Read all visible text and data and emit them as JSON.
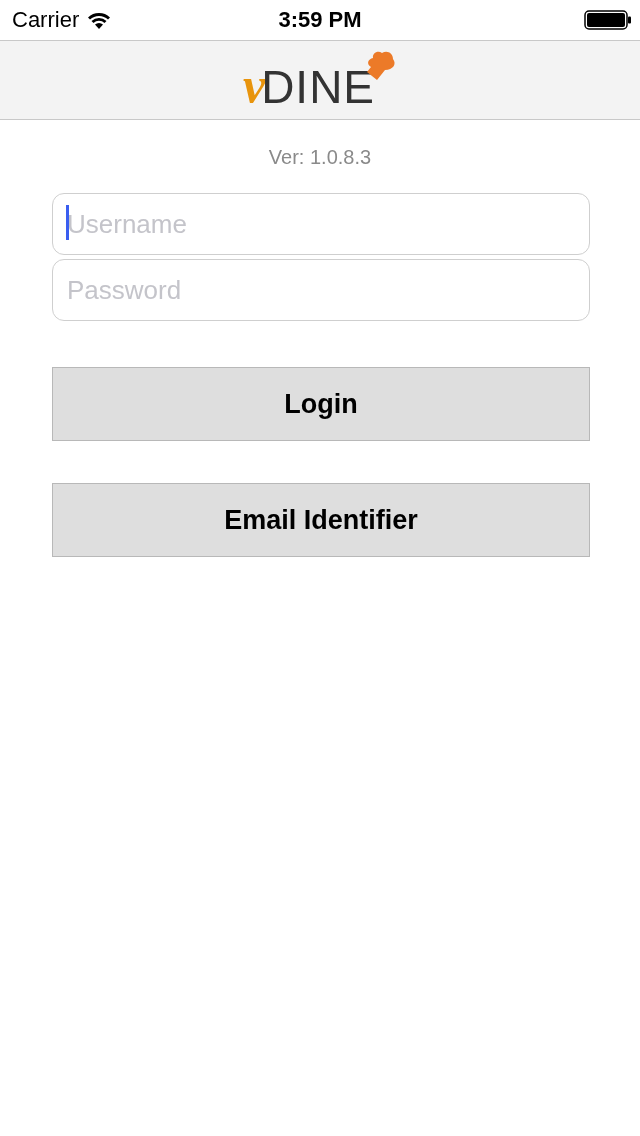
{
  "status_bar": {
    "carrier": "Carrier",
    "time": "3:59 PM"
  },
  "header": {
    "logo": {
      "accent": "v",
      "text": "DINE"
    }
  },
  "version": "Ver: 1.0.8.3",
  "fields": [
    {
      "placeholder": "Username",
      "focused": true
    },
    {
      "placeholder": "Password",
      "focused": false
    }
  ],
  "buttons": [
    "Login",
    "Email Identifier"
  ]
}
